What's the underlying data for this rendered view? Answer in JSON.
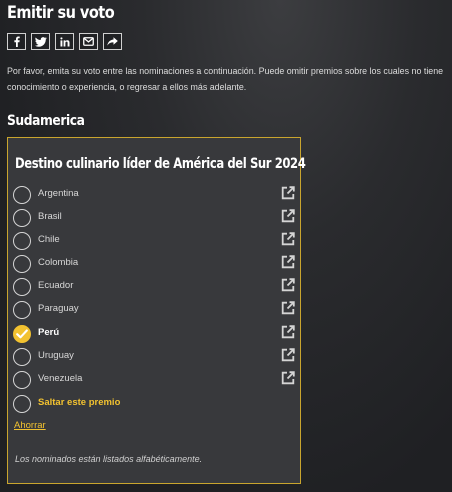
{
  "page": {
    "title": "Emitir su voto",
    "intro": "Por favor, emita su voto entre las nominaciones a continuación. Puede omitir premios sobre los cuales no tiene conocimiento o experiencia, o regresar a ellos más adelante."
  },
  "share": [
    {
      "name": "facebook-icon"
    },
    {
      "name": "twitter-icon"
    },
    {
      "name": "linkedin-icon"
    },
    {
      "name": "email-icon"
    },
    {
      "name": "share-icon"
    }
  ],
  "section": {
    "title": "Sudamerica"
  },
  "award": {
    "title": "Destino culinario líder de América del Sur 2024",
    "selected": "Perú",
    "options": [
      {
        "label": "Argentina"
      },
      {
        "label": "Brasil"
      },
      {
        "label": "Chile"
      },
      {
        "label": "Colombia"
      },
      {
        "label": "Ecuador"
      },
      {
        "label": "Paraguay"
      },
      {
        "label": "Perú"
      },
      {
        "label": "Uruguay"
      },
      {
        "label": "Venezuela"
      }
    ],
    "skip_label": "Saltar este premio",
    "save_label": "Ahorrar",
    "note": "Los nominados están listados alfabéticamente."
  },
  "colors": {
    "accent": "#f2c230",
    "card_background": "#38393c",
    "card_border": "#c9a52e",
    "page_background": "#1f2023"
  }
}
